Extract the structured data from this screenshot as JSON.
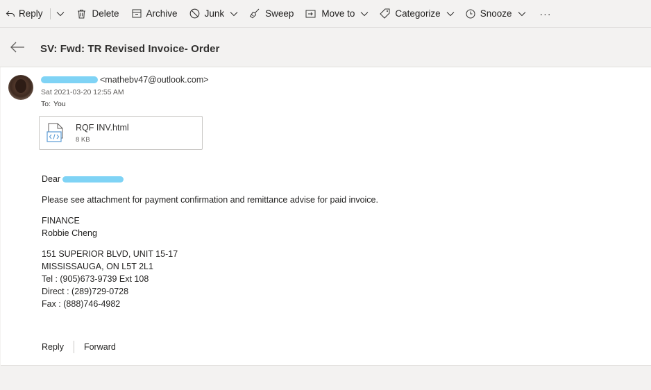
{
  "toolbar": {
    "reply": "Reply",
    "delete": "Delete",
    "archive": "Archive",
    "junk": "Junk",
    "sweep": "Sweep",
    "move_to": "Move to",
    "categorize": "Categorize",
    "snooze": "Snooze",
    "more": "···"
  },
  "message": {
    "subject": "SV: Fwd: TR Revised Invoice- Order",
    "sender_email": "<mathebv47@outlook.com>",
    "date": "Sat 2021-03-20 12:55 AM",
    "to_label": "To:",
    "to_value": "You",
    "attachment": {
      "name": "RQF INV.html",
      "size": "8 KB"
    },
    "body": {
      "greeting": "Dear",
      "line1": "Please see attachment for payment confirmation and remittance advise for paid invoice.",
      "dept": "FINANCE",
      "name": "Robbie Cheng",
      "address1": "151 SUPERIOR BLVD, UNIT 15-17",
      "address2": "MISSISSAUGA, ON L5T 2L1",
      "tel": "Tel : (905)673-9739 Ext 108",
      "direct": "Direct : (289)729-0728",
      "fax": "Fax : (888)746-4982"
    }
  },
  "actions": {
    "reply": "Reply",
    "forward": "Forward"
  }
}
